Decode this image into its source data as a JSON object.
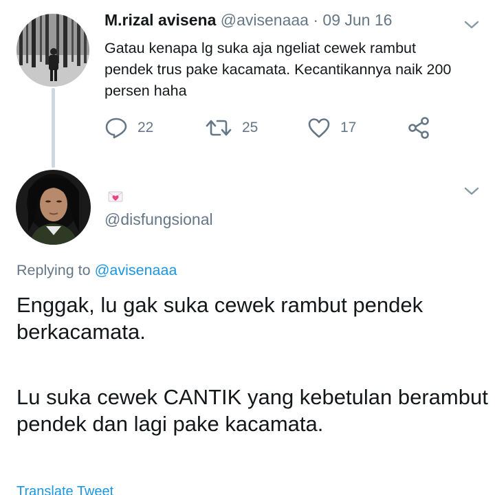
{
  "original_tweet": {
    "author_name": "M.rizal avisena",
    "author_handle": "@avisenaaa",
    "separator": "·",
    "date": "09 Jun 16",
    "text": "Gatau kenapa lg suka aja ngeliat cewek rambut pendek trus pake kacamata. Kecantikannya naik 200 persen haha",
    "actions": {
      "reply_count": "22",
      "retweet_count": "25",
      "like_count": "17"
    },
    "icons": [
      "reply-icon",
      "retweet-icon",
      "heart-icon",
      "share-icon",
      "chevron-down-icon"
    ]
  },
  "reply_tweet": {
    "display_name_emoji": "pink-heart-envelope",
    "handle": "@disfungsional",
    "replying_prefix": "Replying to",
    "replying_to_handle": "@avisenaaa",
    "text_paragraph_1": "Enggak, lu gak suka cewek rambut pendek berkacamata.",
    "text_paragraph_2": "Lu suka cewek CANTIK yang kebetulan berambut pendek dan lagi pake kacamata.",
    "translate_label": "Translate Tweet"
  },
  "colors": {
    "text": "#14171a",
    "secondary": "#657786",
    "link": "#1b95e0",
    "thread_line": "#cdd8e1"
  }
}
